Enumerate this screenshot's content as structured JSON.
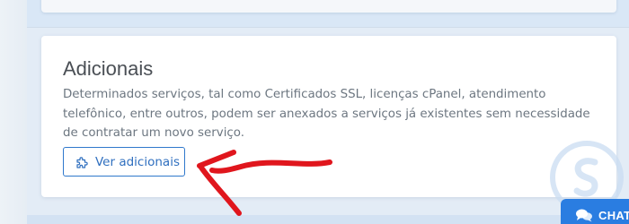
{
  "addons_card": {
    "title": "Adicionais",
    "description": "Determinados serviços, tal como Certificados SSL, licenças cPanel, atendimento telefônico, entre outros, podem ser anexados a serviços já existentes sem necessidade de contratar um novo serviço.",
    "button_label": "Ver adicionais",
    "button_icon": "puzzle-icon"
  },
  "chat": {
    "label": "CHAT",
    "icon": "chat-bubbles-icon"
  },
  "annotation": {
    "arrow_color": "#e0161d",
    "arrow_icon": "red-arrow-annotation"
  },
  "colors": {
    "accent": "#2f78cc",
    "chat_bg": "#2a7de1",
    "page_bg": "#d9e7f6",
    "card_bg": "#ffffff",
    "title_text": "#4a4f55",
    "body_text": "#6c7680"
  }
}
